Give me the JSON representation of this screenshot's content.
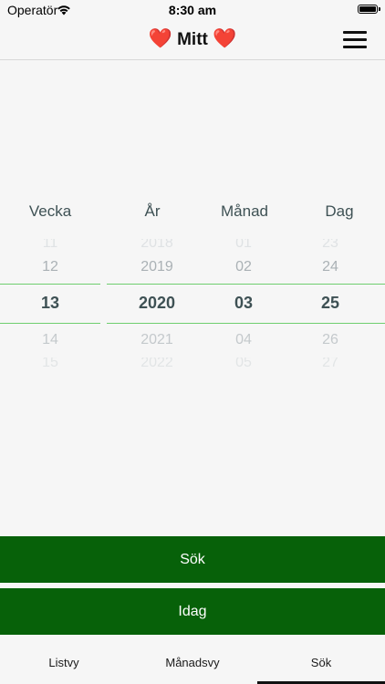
{
  "status_bar": {
    "carrier": "Operatör",
    "time": "8:30 am"
  },
  "nav": {
    "title": "Mitt",
    "heart_icon": "❤️",
    "menu_icon": "hamburger-menu-icon"
  },
  "picker": {
    "headers": {
      "week": "Vecka",
      "year": "År",
      "month": "Månad",
      "day": "Dag"
    },
    "week": {
      "faint": "11",
      "prev": "12",
      "selected": "13",
      "next": "14",
      "faint_next": "15"
    },
    "year": {
      "faint": "2018",
      "prev": "2019",
      "selected": "2020",
      "next": "2021",
      "faint_next": "2022"
    },
    "month": {
      "faint": "01",
      "prev": "02",
      "selected": "03",
      "next": "04",
      "faint_next": "05"
    },
    "day": {
      "faint": "23",
      "prev": "24",
      "selected": "25",
      "next": "26",
      "faint_next": "27"
    },
    "selection_color": "#6fce6f"
  },
  "buttons": {
    "search": "Sök",
    "today": "Idag"
  },
  "tabs": {
    "list": "Listvy",
    "month": "Månadsvy",
    "search": "Sök",
    "active": "search"
  },
  "colors": {
    "primary_green": "#076109",
    "text_dark": "#3e5154"
  }
}
